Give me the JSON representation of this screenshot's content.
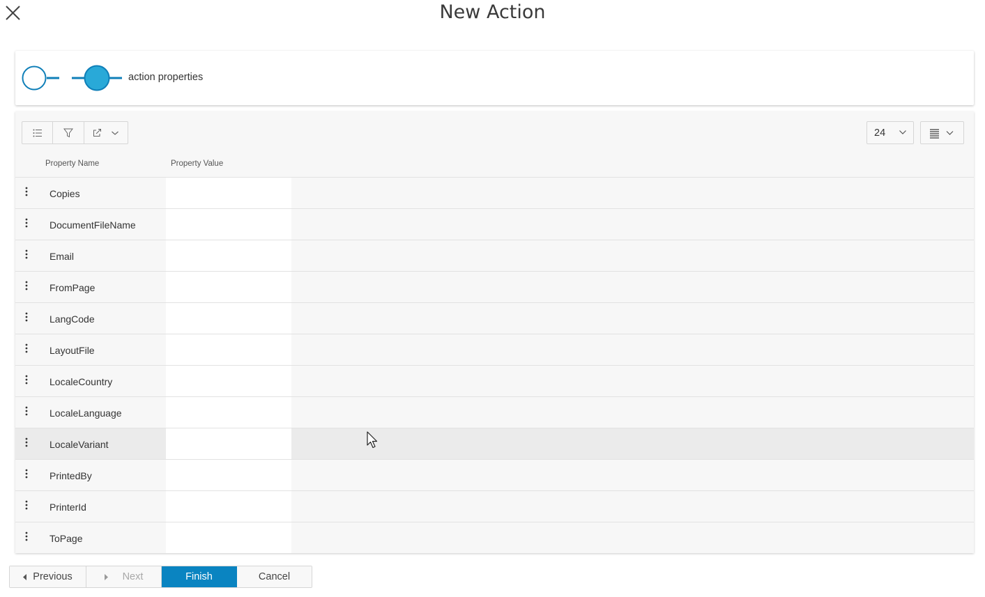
{
  "dialog": {
    "title": "New Action"
  },
  "stepper": {
    "steps": [
      {
        "label": "",
        "state": "incomplete"
      },
      {
        "label": "action properties",
        "state": "active"
      }
    ],
    "accent": "#0f7fb8",
    "active_fill": "#29a9d8"
  },
  "toolbar": {
    "buttons": [
      "list-icon",
      "filter-icon",
      "export-icon"
    ],
    "page_size": "24",
    "density_icon": "lines-icon"
  },
  "table": {
    "columns": [
      "Property Name",
      "Property Value"
    ],
    "rows": [
      {
        "name": "Copies",
        "value": ""
      },
      {
        "name": "DocumentFileName",
        "value": ""
      },
      {
        "name": "Email",
        "value": ""
      },
      {
        "name": "FromPage",
        "value": ""
      },
      {
        "name": "LangCode",
        "value": ""
      },
      {
        "name": "LayoutFile",
        "value": ""
      },
      {
        "name": "LocaleCountry",
        "value": ""
      },
      {
        "name": "LocaleLanguage",
        "value": ""
      },
      {
        "name": "LocaleVariant",
        "value": ""
      },
      {
        "name": "PrintedBy",
        "value": ""
      },
      {
        "name": "PrinterId",
        "value": ""
      },
      {
        "name": "ToPage",
        "value": ""
      }
    ],
    "hovered_row": 8
  },
  "footer": {
    "previous_label": "Previous",
    "next_label": "Next",
    "finish_label": "Finish",
    "cancel_label": "Cancel",
    "primary_color": "#0a84c1"
  }
}
